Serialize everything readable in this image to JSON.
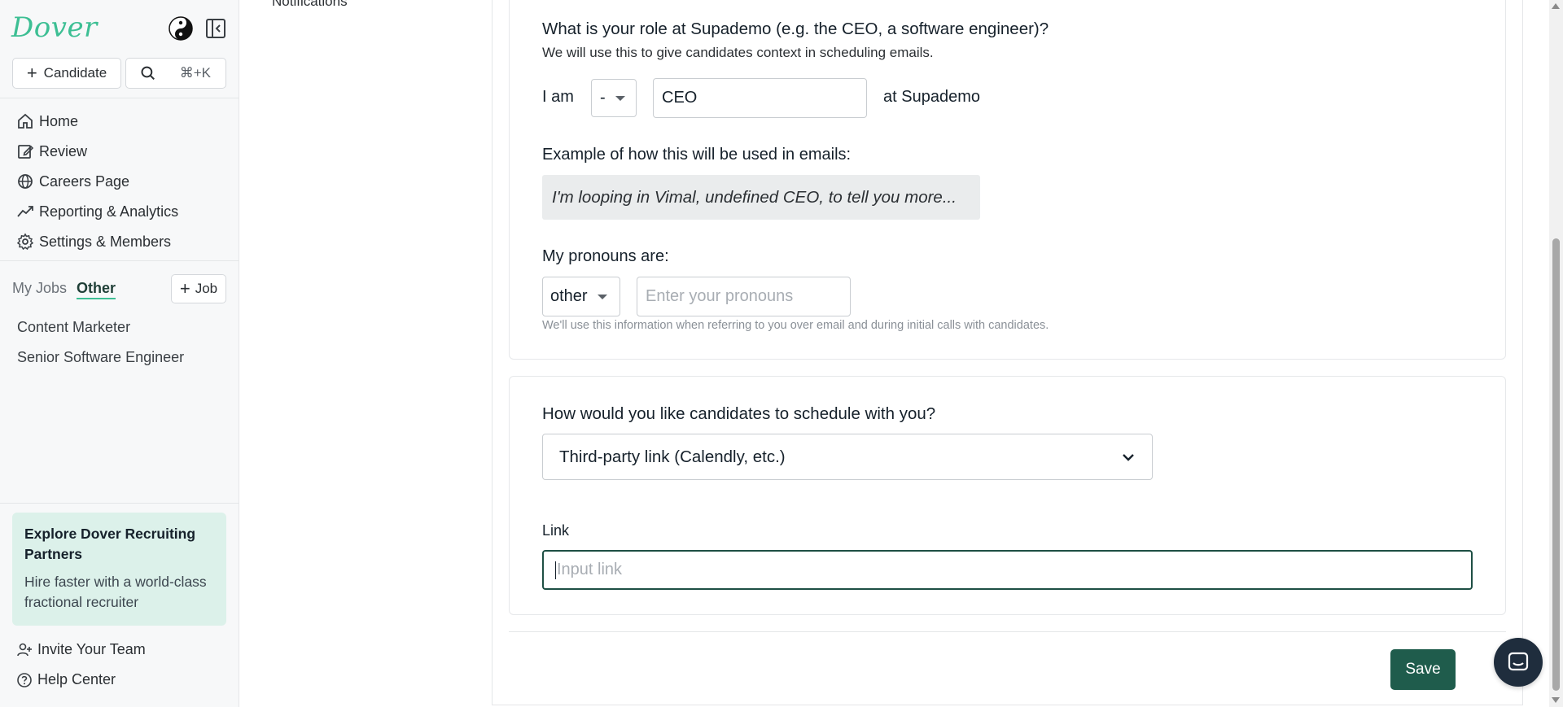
{
  "sidebar": {
    "logo": "Dover",
    "candidate_button": "Candidate",
    "search_shortcut": "⌘+K",
    "nav": [
      {
        "label": "Home",
        "icon": "home-icon"
      },
      {
        "label": "Review",
        "icon": "review-icon"
      },
      {
        "label": "Careers Page",
        "icon": "globe-icon"
      },
      {
        "label": "Reporting & Analytics",
        "icon": "trending-up-icon"
      },
      {
        "label": "Settings & Members",
        "icon": "gear-icon"
      }
    ],
    "jobs_tabs": {
      "my_jobs": "My Jobs",
      "other": "Other",
      "active": "Other"
    },
    "job_button": "Job",
    "jobs": [
      "Content Marketer",
      "Senior Software Engineer"
    ],
    "promo": {
      "title": "Explore Dover Recruiting Partners",
      "body": "Hire faster with a world-class fractional recruiter"
    },
    "footer": {
      "invite": "Invite Your Team",
      "help": "Help Center"
    }
  },
  "settings_nav": {
    "notifications": "Notifications"
  },
  "role_card": {
    "question": "What is your role at Supademo (e.g. the CEO, a software engineer)?",
    "subtitle": "We will use this to give candidates context in scheduling emails.",
    "i_am": "I am",
    "article_value": "-",
    "role_value": "CEO",
    "at_company": "at Supademo",
    "example_label": "Example of how this will be used in emails:",
    "example_text": "I'm looping in Vimal, undefined CEO, to tell you more...",
    "pronouns_label": "My pronouns are:",
    "pronouns_select": "other",
    "pronouns_placeholder": "Enter your pronouns",
    "pronouns_hint": "We'll use this information when referring to you over email and during initial calls with candidates."
  },
  "schedule_card": {
    "question": "How would you like candidates to schedule with you?",
    "method_value": "Third-party link (Calendly, etc.)",
    "link_label": "Link",
    "link_placeholder": "Input link"
  },
  "actions": {
    "save": "Save"
  },
  "colors": {
    "brand": "#3dbf94",
    "primary_button": "#1f5c4c",
    "promo_bg": "#dcf1ea"
  }
}
